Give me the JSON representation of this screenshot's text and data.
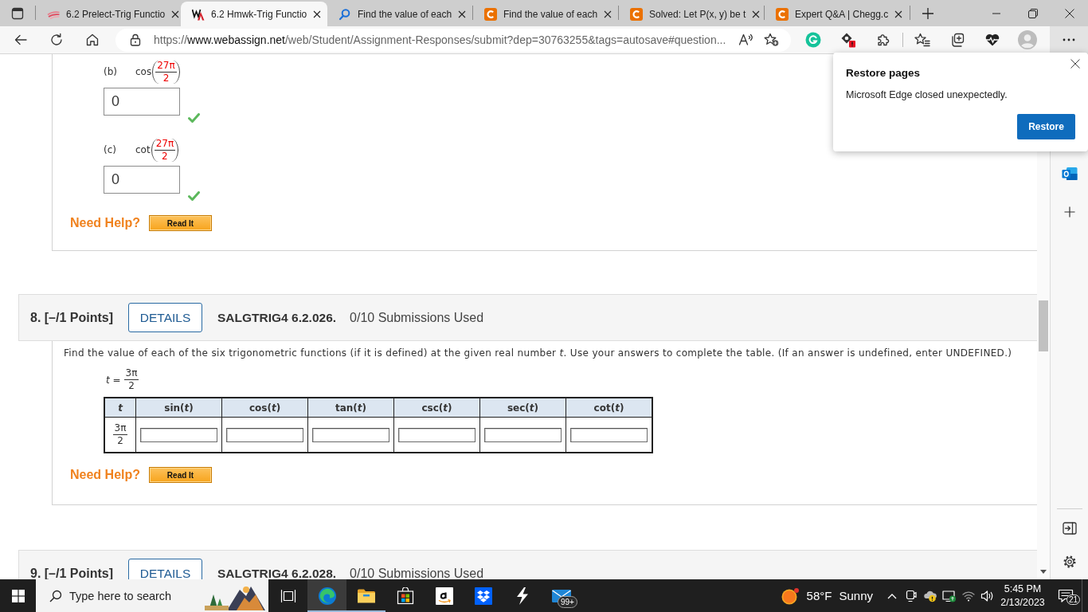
{
  "browser": {
    "tabs": [
      {
        "kind": "swoosh",
        "title": "6.2 Prelect-Trig Functio",
        "selected": false
      },
      {
        "kind": "webassign",
        "title": "6.2 Hmwk-Trig Functio",
        "selected": true
      },
      {
        "kind": "search",
        "title": "Find the value of each",
        "selected": false
      },
      {
        "kind": "chegg",
        "title": "Find the value of each",
        "selected": false
      },
      {
        "kind": "chegg",
        "title": "Solved: Let P(x, y) be t",
        "selected": false
      },
      {
        "kind": "chegg",
        "title": "Expert Q&A | Chegg.c",
        "selected": false
      }
    ],
    "url": {
      "scheme": "https://",
      "host": "www.webassign.net",
      "path": "/web/Student/Assignment-Responses/submit?dep=30763255&tags=autosave#question..."
    }
  },
  "restore_popup": {
    "title": "Restore pages",
    "message": "Microsoft Edge closed unexpectedly.",
    "button": "Restore"
  },
  "questions": [
    {
      "parts": [
        {
          "label": "(b)",
          "function": "cos",
          "numerator": "27π",
          "denominator": "2",
          "answer": "0",
          "correct": true
        },
        {
          "label": "(c)",
          "function": "cot",
          "numerator": "27π",
          "denominator": "2",
          "answer": "0",
          "correct": true
        }
      ],
      "help": {
        "label": "Need Help?",
        "button": "Read It"
      }
    },
    {
      "header": {
        "number": "8. [–/1 Points]",
        "details": "DETAILS",
        "code": "SALGTRIG4 6.2.026.",
        "submissions": "0/10 Submissions Used"
      },
      "prompt": "Find the value of each of the six trigonometric functions (if it is defined) at the given real number *t*. Use your answers to complete the table. (If an answer is undefined, enter UNDEFINED.)",
      "given": {
        "lhs": "*t* =",
        "numerator": "3π",
        "denominator": "2"
      },
      "table": {
        "columns": [
          {
            "label": "t",
            "kind": "variable"
          },
          {
            "label": "sin(*t*)",
            "kind": "function"
          },
          {
            "label": "cos(*t*)",
            "kind": "function"
          },
          {
            "label": "tan(*t*)",
            "kind": "function"
          },
          {
            "label": "csc(*t*)",
            "kind": "function"
          },
          {
            "label": "sec(*t*)",
            "kind": "function"
          },
          {
            "label": "cot(*t*)",
            "kind": "function"
          }
        ],
        "rows": [
          {
            "numerator": "3π",
            "denominator": "2"
          }
        ]
      },
      "help": {
        "label": "Need Help?",
        "button": "Read It"
      }
    },
    {
      "header": {
        "number": "9. [–/1 Points]",
        "details": "DETAILS",
        "code": "SALGTRIG4 6.2.028.",
        "submissions": "0/10 Submissions Used"
      }
    }
  ],
  "taskbar": {
    "search_placeholder": "Type here to search",
    "apps": [
      {
        "kind": "taskview",
        "selected": false,
        "running": false
      },
      {
        "kind": "edge",
        "selected": true,
        "running": true
      },
      {
        "kind": "explorer",
        "selected": false,
        "running": true
      },
      {
        "kind": "store",
        "selected": false,
        "running": false
      },
      {
        "kind": "amazon",
        "selected": false,
        "running": false
      },
      {
        "kind": "dropbox",
        "selected": false,
        "running": false
      },
      {
        "kind": "bolt",
        "selected": false,
        "running": false
      },
      {
        "kind": "mail",
        "selected": false,
        "running": false,
        "badge": "99+"
      }
    ],
    "weather": {
      "temperature": "58°F",
      "condition": "Sunny"
    },
    "clock": {
      "time": "5:45 PM",
      "date": "2/13/2023"
    },
    "notifications": "21"
  }
}
